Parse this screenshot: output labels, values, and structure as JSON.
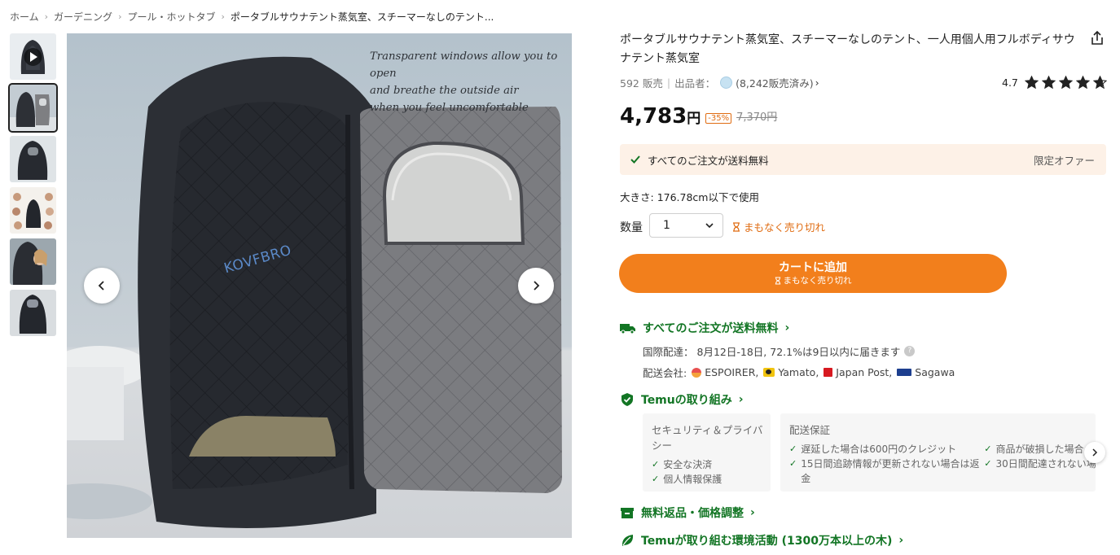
{
  "breadcrumb": {
    "items": [
      "ホーム",
      "ガーデニング",
      "プール・ホットタブ"
    ],
    "current": "ポータブルサウナテント蒸気室、スチーマーなしのテント..."
  },
  "gallery": {
    "thumb_count": 6,
    "selected_index": 1,
    "overlay_text": [
      "Transparent windows allow you to open",
      "and breathe the outside air",
      "when you feel uncomfortable"
    ],
    "brand": "KOVFBRO"
  },
  "product": {
    "title": "ポータブルサウナテント蒸気室、スチーマーなしのテント、一人用個人用フルボディサウナテント蒸気室",
    "sold": "592 販売",
    "seller_label": "出品者：",
    "seller_sales": "(8,242販売済み)",
    "rating": "4.7",
    "rating_value": 4.7,
    "price": "4,783",
    "price_unit": "円",
    "discount": "-35%",
    "original_price": "7,370円"
  },
  "offer": {
    "text": "すべてのご注文が送料無料",
    "tag": "限定オファー"
  },
  "size": {
    "label": "大きさ: ",
    "value": "176.78cm以下で使用"
  },
  "quantity": {
    "label": "数量",
    "value": "1",
    "warning": "まもなく売り切れ"
  },
  "cart": {
    "label": "カートに追加",
    "sub": "まもなく売り切れ"
  },
  "shipping": {
    "heading": "すべてのご注文が送料無料",
    "intl_label": "国際配達：",
    "intl_value": "8月12日-18日, 72.1%は9日以内に届きます",
    "carriers_label": "配送会社:",
    "carriers": [
      "ESPOIRER,",
      "Yamato,",
      "Japan Post,",
      "Sagawa"
    ]
  },
  "commitment": {
    "heading": "Temuの取り組み",
    "cards": [
      {
        "title": "セキュリティ＆プライバシー",
        "items": [
          "安全な決済",
          "個人情報保護"
        ]
      },
      {
        "title": "配送保証",
        "items": [
          "遅延した場合は600円のクレジット",
          "15日間追跡情報が更新されない場合は返金"
        ]
      },
      {
        "title": "",
        "items": [
          "商品が破損した場合",
          "30日間配達されない場"
        ]
      }
    ]
  },
  "returns": {
    "heading": "無料返品・価格調整"
  },
  "eco": {
    "heading": "Temuが取り組む環境活動 (1300万本以上の木)"
  },
  "colors": {
    "accent_orange": "#f27f1c",
    "warning_orange": "#e06c12",
    "brand_green": "#127524",
    "offer_bg": "#fdf1e7"
  }
}
